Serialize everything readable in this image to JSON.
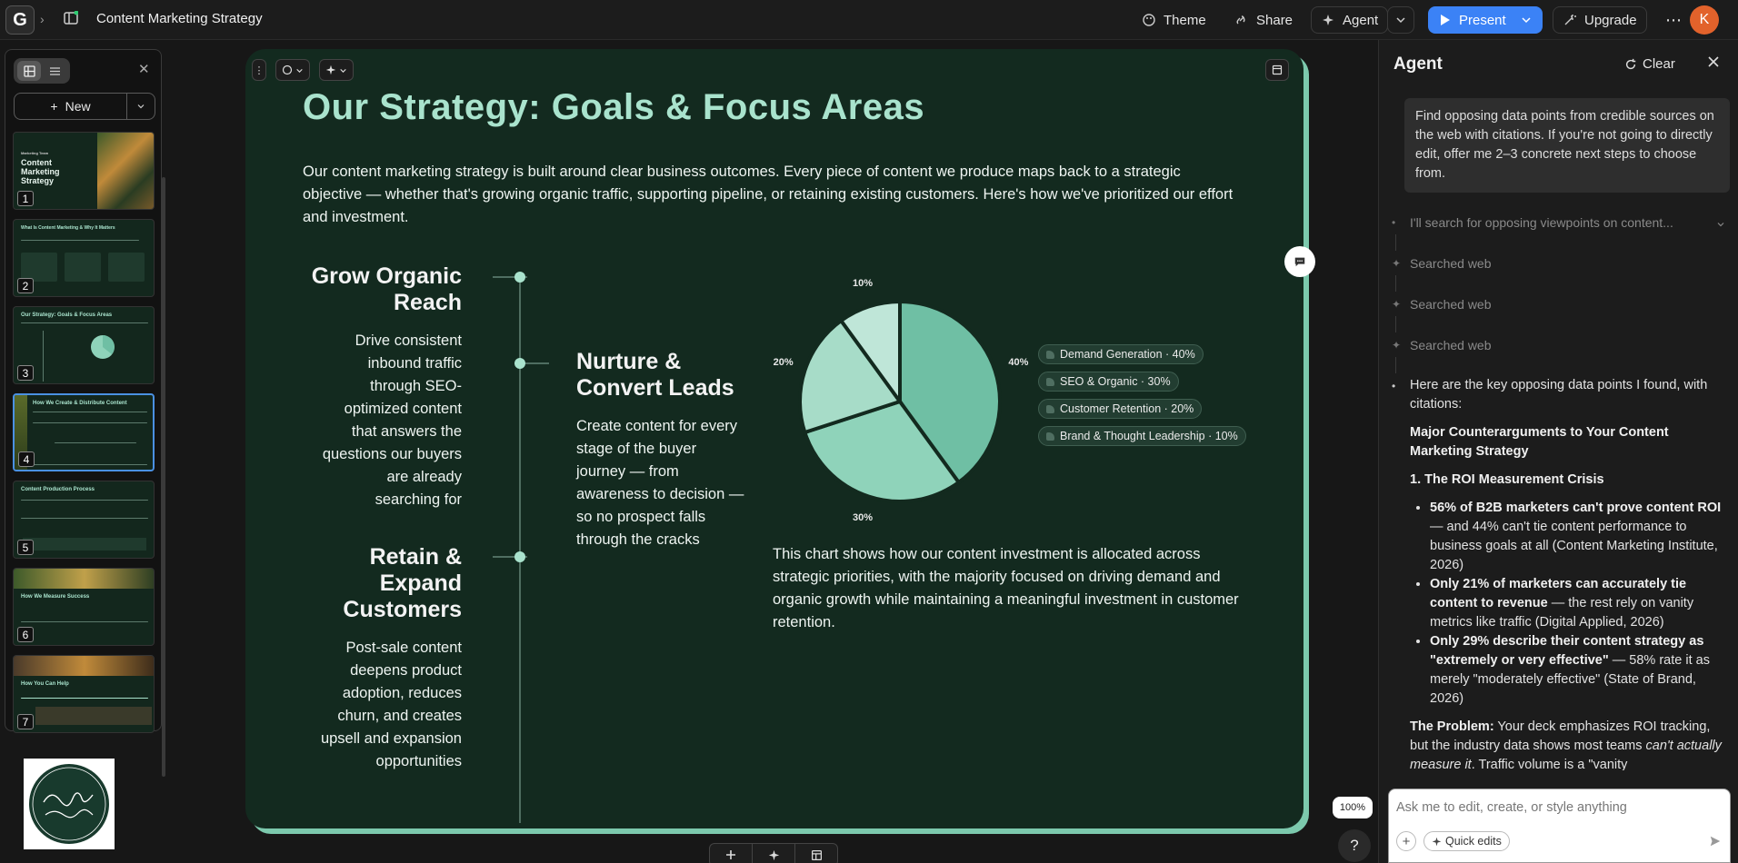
{
  "topbar": {
    "doc_title": "Content Marketing Strategy",
    "theme_label": "Theme",
    "share_label": "Share",
    "agent_label": "Agent",
    "present_label": "Present",
    "upgrade_label": "Upgrade",
    "avatar_initial": "K",
    "logo_letter": "G"
  },
  "leftpanel": {
    "new_label": "New",
    "thumbnails": [
      {
        "num": "1",
        "title": "Content Marketing Strategy",
        "kicker": "Marketing Team"
      },
      {
        "num": "2",
        "title": "What Is Content Marketing & Why It Matters"
      },
      {
        "num": "3",
        "title": "Our Strategy: Goals & Focus Areas"
      },
      {
        "num": "4",
        "title": "How We Create & Distribute Content"
      },
      {
        "num": "5",
        "title": "Content Production Process"
      },
      {
        "num": "6",
        "title": "How We Measure Success"
      },
      {
        "num": "7",
        "title": "How You Can Help"
      }
    ]
  },
  "slide": {
    "title": "Our Strategy: Goals & Focus Areas",
    "intro": "Our content marketing strategy is built around clear business outcomes. Every piece of content we produce maps back to a strategic objective — whether that's growing organic traffic, supporting pipeline, or retaining existing customers. Here's how we've prioritized our effort and investment.",
    "goals": [
      {
        "heading": "Grow Organic Reach",
        "body": "Drive consistent inbound traffic through SEO-optimized content that answers the questions our buyers are already searching for"
      },
      {
        "heading": "Nurture & Convert Leads",
        "body": "Create content for every stage of the buyer journey — from awareness to decision — so no prospect falls through the cracks"
      },
      {
        "heading": "Retain & Expand Customers",
        "body": "Post-sale content deepens product adoption, reduces churn, and creates upsell and expansion opportunities"
      }
    ],
    "chart_caption": "This chart shows how our content investment is allocated across strategic priorities, with the majority focused on driving demand and organic growth while maintaining a meaningful investment in customer retention.",
    "zoom": "100%"
  },
  "chart_data": {
    "type": "pie",
    "categories": [
      "Demand Generation",
      "SEO & Organic",
      "Customer Retention",
      "Brand & Thought Leadership"
    ],
    "values": [
      40,
      30,
      20,
      10
    ],
    "value_labels": [
      "40%",
      "30%",
      "20%",
      "10%"
    ],
    "legend_separator": "·",
    "legend_placement": "right",
    "colors": [
      "#6fbfa4",
      "#8fd3ba",
      "#a7dcc8",
      "#bfe6d8"
    ]
  },
  "agent": {
    "title": "Agent",
    "clear_label": "Clear",
    "user_message": "Find opposing data points from credible sources on the web with citations. If you're not going to directly edit, offer me 2–3 concrete next steps to choose from.",
    "steps": {
      "thinking": "I'll search for opposing viewpoints on content...",
      "searched": [
        "Searched web",
        "Searched web",
        "Searched web"
      ]
    },
    "answer": {
      "intro": "Here are the key opposing data points I found, with citations:",
      "section_title": "Major Counterarguments to Your Content Marketing Strategy",
      "point_title": "1. The ROI Measurement Crisis",
      "bullets": [
        {
          "bold": "56% of B2B marketers can't prove content ROI",
          "rest": " — and 44% can't tie content performance to business goals at all (Content Marketing Institute, 2026)"
        },
        {
          "bold": "Only 21% of marketers can accurately tie content to revenue",
          "rest": " — the rest rely on vanity metrics like traffic (Digital Applied, 2026)"
        },
        {
          "bold": "Only 29% describe their content strategy as \"extremely or very effective\"",
          "rest": " — 58% rate it as merely \"moderately effective\" (State of Brand, 2026)"
        }
      ],
      "problem_label": "The Problem:",
      "problem_text_1": " Your deck emphasizes ROI tracking, but the industry data shows most teams ",
      "problem_em": "can't actually measure it",
      "problem_text_2": ". Traffic volume is a \"vanity"
    },
    "input_placeholder": "Ask me to edit, create, or style anything",
    "quick_edits_label": "Quick edits"
  }
}
